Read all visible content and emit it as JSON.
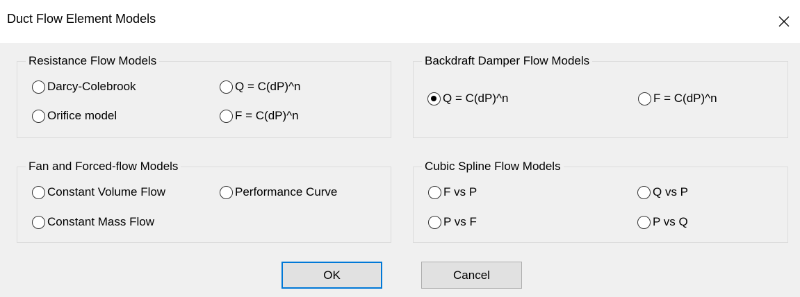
{
  "dialog": {
    "title": "Duct Flow Element Models",
    "close_icon": "close-icon"
  },
  "resistance": {
    "legend": "Resistance Flow Models",
    "options": [
      {
        "label": "Darcy-Colebrook",
        "checked": false
      },
      {
        "label": "Q = C(dP)^n",
        "checked": false
      },
      {
        "label": "Orifice model",
        "checked": false
      },
      {
        "label": "F = C(dP)^n",
        "checked": false
      }
    ]
  },
  "backdraft": {
    "legend": "Backdraft Damper Flow Models",
    "options": [
      {
        "label": "Q = C(dP)^n",
        "checked": true
      },
      {
        "label": "F = C(dP)^n",
        "checked": false
      }
    ]
  },
  "fan": {
    "legend": "Fan and Forced-flow Models",
    "options": [
      {
        "label": "Constant Volume Flow",
        "checked": false
      },
      {
        "label": "Performance Curve",
        "checked": false
      },
      {
        "label": "Constant Mass Flow",
        "checked": false
      }
    ]
  },
  "spline": {
    "legend": "Cubic Spline Flow Models",
    "options": [
      {
        "label": "F vs P",
        "checked": false
      },
      {
        "label": "Q vs P",
        "checked": false
      },
      {
        "label": "P vs F",
        "checked": false
      },
      {
        "label": "P vs Q",
        "checked": false
      }
    ]
  },
  "buttons": {
    "ok_label": "OK",
    "cancel_label": "Cancel"
  },
  "colors": {
    "default_button_border": "#0078d7",
    "dialog_background": "#f0f0f0"
  }
}
